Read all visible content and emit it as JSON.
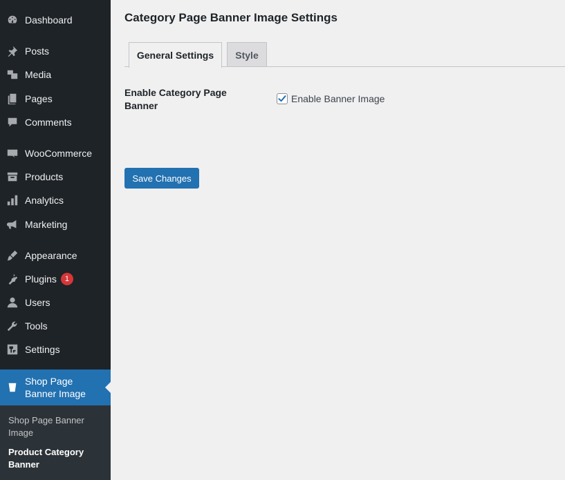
{
  "sidebar": {
    "items": [
      {
        "label": "Dashboard",
        "icon": "dashboard-icon"
      },
      {
        "label": "Posts",
        "icon": "pin-icon"
      },
      {
        "label": "Media",
        "icon": "media-icon"
      },
      {
        "label": "Pages",
        "icon": "pages-icon"
      },
      {
        "label": "Comments",
        "icon": "comment-icon"
      },
      {
        "label": "WooCommerce",
        "icon": "woocommerce-icon"
      },
      {
        "label": "Products",
        "icon": "archive-icon"
      },
      {
        "label": "Analytics",
        "icon": "bar-chart-icon"
      },
      {
        "label": "Marketing",
        "icon": "megaphone-icon"
      },
      {
        "label": "Appearance",
        "icon": "brush-icon"
      },
      {
        "label": "Plugins",
        "icon": "plug-icon",
        "badge": "1"
      },
      {
        "label": "Users",
        "icon": "user-icon"
      },
      {
        "label": "Tools",
        "icon": "wrench-icon"
      },
      {
        "label": "Settings",
        "icon": "settings-icon"
      }
    ],
    "active_item": {
      "label_line1": "Shop Page",
      "label_line2": "Banner Image",
      "icon": "banner-icon"
    },
    "submenu": [
      {
        "label_line1": "Shop Page Banner",
        "label_line2": "Image"
      },
      {
        "label_line1": "Product Category",
        "label_line2": "Banner"
      }
    ]
  },
  "main": {
    "title": "Category Page Banner Image Settings",
    "tabs": [
      {
        "label": "General Settings",
        "active": true
      },
      {
        "label": "Style",
        "active": false
      }
    ],
    "field": {
      "label_line1": "Enable Category Page",
      "label_line2": "Banner",
      "checkbox_label": "Enable Banner Image",
      "checked": true
    },
    "save_label": "Save Changes"
  },
  "colors": {
    "sidebar_bg": "#1d2327",
    "accent": "#2271b1",
    "badge": "#d63638",
    "page_bg": "#f0f0f1"
  }
}
